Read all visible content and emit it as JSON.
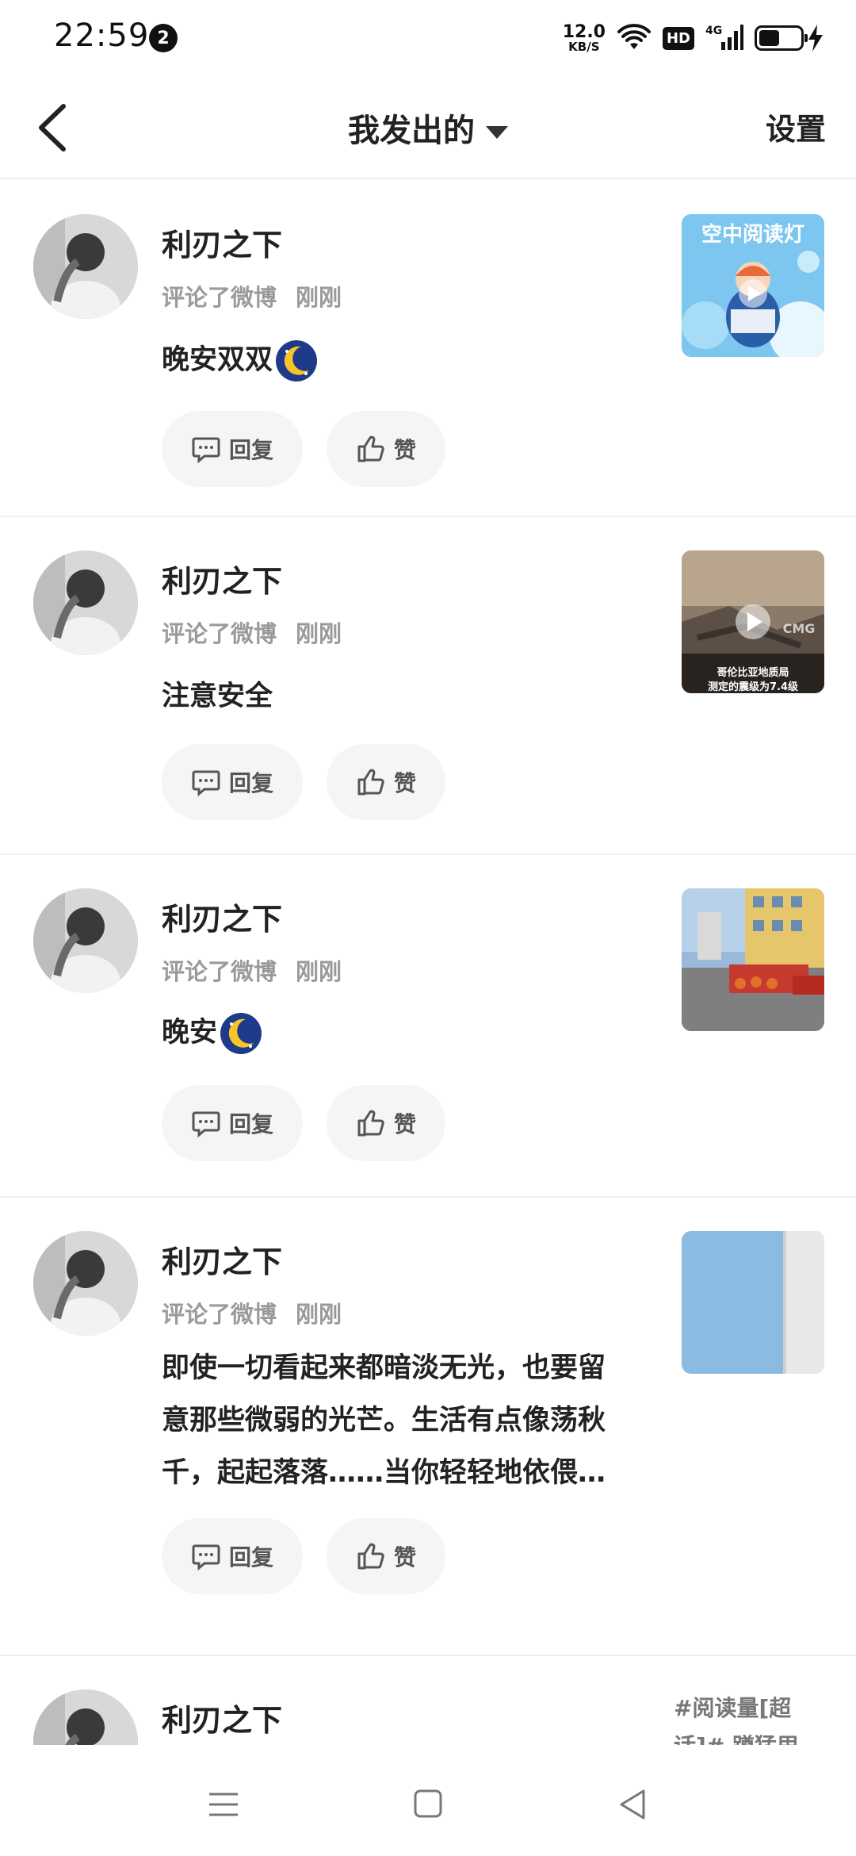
{
  "status_bar": {
    "time": "22:59",
    "notification_count": "2",
    "net_speed_value": "12.0",
    "net_speed_unit": "KB/S",
    "hd_label": "HD",
    "network_label": "4G",
    "battery_level": 0.5
  },
  "nav": {
    "title": "我发出的",
    "settings_label": "设置"
  },
  "feed": {
    "items": [
      {
        "user": "利刃之下",
        "action": "评论了微博",
        "time": "刚刚",
        "comment": "晚安双双",
        "has_moon": true,
        "reply_label": "回复",
        "like_label": "赞",
        "thumb_text_1": "空中阅读灯",
        "thumb_text_2": ""
      },
      {
        "user": "利刃之下",
        "action": "评论了微博",
        "time": "刚刚",
        "comment": "注意安全",
        "has_moon": false,
        "reply_label": "回复",
        "like_label": "赞",
        "thumb_text_1": "哥伦比亚地质局",
        "thumb_text_2": "测定的震级为7.4级",
        "thumb_watermark": "CMG"
      },
      {
        "user": "利刃之下",
        "action": "评论了微博",
        "time": "刚刚",
        "comment": "晚安",
        "has_moon": true,
        "reply_label": "回复",
        "like_label": "赞"
      },
      {
        "user": "利刃之下",
        "action": "评论了微博",
        "time": "刚刚",
        "comment": "即使一切看起来都暗淡无光，也要留意那些微弱的光芒。生活有点像荡秋千，起起落落……当你轻轻地依偎…",
        "has_moon": false,
        "reply_label": "回复",
        "like_label": "赞"
      },
      {
        "user": "利刃之下",
        "tags_preview": "#阅读量[超话]# 蹲猛甩"
      }
    ]
  },
  "colors": {
    "accent_text": "#222222",
    "meta_text": "#9a9a9a",
    "pill_bg": "#f5f5f5",
    "divider": "#efefef"
  }
}
